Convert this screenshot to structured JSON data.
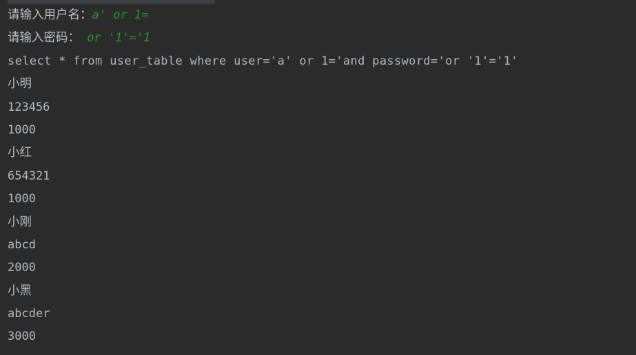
{
  "window": {
    "background_color": "#2b2b2b",
    "top_strip_color": "#3c3f41"
  },
  "colors": {
    "default_text": "#b3b8bd",
    "user_input_green": "#1e9e1e",
    "sql_text": "#b0b5ba"
  },
  "console": {
    "prompts": [
      {
        "label": "请输入用户名：",
        "value": "a' or 1="
      },
      {
        "label": "请输入密码：",
        "value": " or '1'='1"
      }
    ],
    "sql_query": "select * from user_table where user='a' or 1='and password='or '1'='1'",
    "results": [
      "小明",
      "123456",
      "1000",
      "小红",
      "654321",
      "1000",
      "小刚",
      "abcd",
      "2000",
      "小黑",
      "abcder",
      "3000"
    ]
  }
}
